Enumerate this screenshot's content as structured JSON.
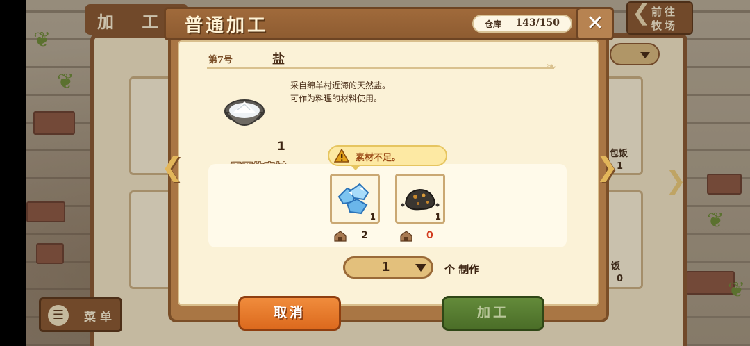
{
  "background": {
    "screen_title": "加 工",
    "goto_ranch_label": "前往牧场",
    "menu_label": "菜单",
    "bg_card_texts": [
      "包饭",
      "1",
      "饭",
      "0"
    ]
  },
  "dialog": {
    "title": "普通加工",
    "storage_label": "仓库",
    "storage_value": "143/150",
    "close_label": "✕",
    "item_number": "第7号",
    "item_name": "盐",
    "description_lines": [
      "采自绵羊村近海的天然盐。",
      "可作为料理的材料使用。"
    ],
    "output_qty": "1",
    "required_label": "需要的素材",
    "warning_text": "素材不足。",
    "materials": [
      {
        "icon": "ice-crystal-icon",
        "required": "1",
        "owned": "2",
        "owned_color": "#3c2412"
      },
      {
        "icon": "coal-ore-icon",
        "required": "1",
        "owned": "0",
        "owned_color": "#d23a1e"
      }
    ],
    "quantity_value": "1",
    "unit_label": "个 制作",
    "cancel_label": "取消",
    "process_label": "加工"
  },
  "icons": {
    "close": "close-icon",
    "warning": "warning-icon",
    "nav_left": "chevron-left-icon",
    "nav_right": "chevron-right-icon",
    "storehouse": "storehouse-icon",
    "menu": "menu-icon",
    "salt": "salt-bowl-icon"
  }
}
